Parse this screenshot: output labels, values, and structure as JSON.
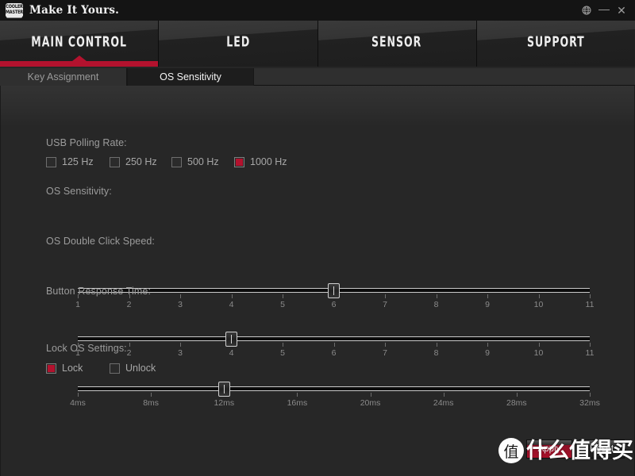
{
  "window": {
    "title": "Make It Yours.",
    "logo_line1": "COOLER",
    "logo_line2": "MASTER",
    "controls": {
      "language_icon": "globe-icon",
      "minimize_label": "—",
      "close_label": "✕"
    }
  },
  "tabs": [
    {
      "label": "MAIN CONTROL",
      "active": true
    },
    {
      "label": "LED",
      "active": false
    },
    {
      "label": "SENSOR",
      "active": false
    },
    {
      "label": "SUPPORT",
      "active": false
    }
  ],
  "subtabs": [
    {
      "label": "Key Assignment",
      "active": false
    },
    {
      "label": "OS Sensitivity",
      "active": true
    }
  ],
  "accent_color": "#b3122e",
  "sections": {
    "polling": {
      "label": "USB Polling Rate:",
      "options": [
        {
          "label": "125 Hz",
          "checked": false
        },
        {
          "label": "250 Hz",
          "checked": false
        },
        {
          "label": "500 Hz",
          "checked": false
        },
        {
          "label": "1000 Hz",
          "checked": true
        }
      ]
    },
    "os_sensitivity": {
      "label": "OS Sensitivity:",
      "value": 6,
      "ticks": [
        "1",
        "2",
        "3",
        "4",
        "5",
        "6",
        "7",
        "8",
        "9",
        "10",
        "11"
      ]
    },
    "double_click": {
      "label": "OS Double Click Speed:",
      "value": 4,
      "ticks": [
        "1",
        "2",
        "3",
        "4",
        "5",
        "6",
        "7",
        "8",
        "9",
        "10",
        "11"
      ]
    },
    "response_time": {
      "label": "Button Response Time:",
      "value": 12,
      "ticks": [
        "4ms",
        "8ms",
        "12ms",
        "16ms",
        "20ms",
        "24ms",
        "28ms",
        "32ms"
      ]
    },
    "lock": {
      "label": "Lock OS Settings:",
      "options": [
        {
          "label": "Lock",
          "checked": true
        },
        {
          "label": "Unlock",
          "checked": false
        }
      ]
    }
  },
  "buttons": [
    {
      "label": "Apply",
      "style": "primary"
    },
    {
      "label": "Reset",
      "style": "secondary"
    }
  ],
  "watermark": {
    "badge": "值",
    "text": "什么值得买"
  }
}
